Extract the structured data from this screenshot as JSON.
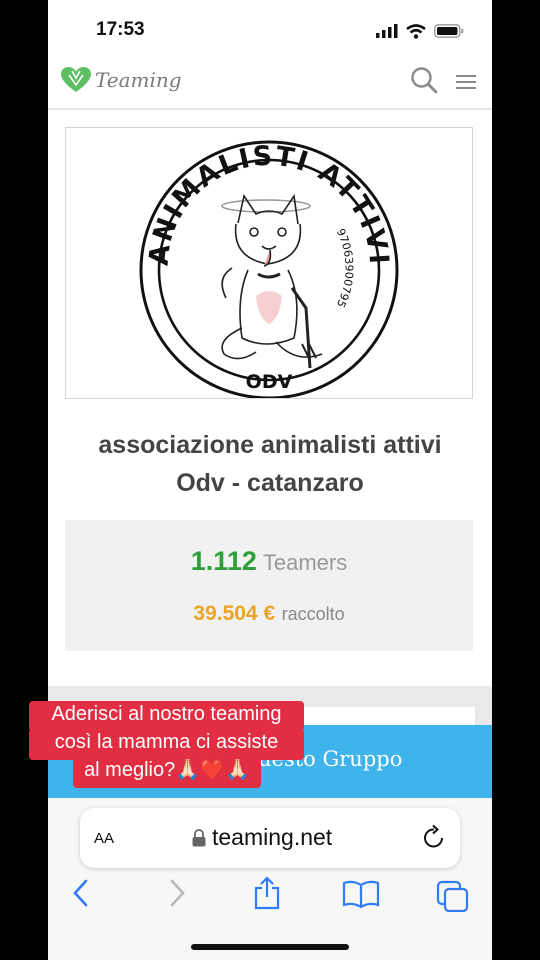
{
  "status_bar": {
    "time": "17:53"
  },
  "site_header": {
    "logo_text": "Teaming"
  },
  "group": {
    "logo_text": "ANIMALISTI ATTIVI",
    "logo_bottom": "ODV",
    "logo_number": "97063900795",
    "name_line1": "associazione animalisti attivi",
    "name_line2": "Odv - catanzaro"
  },
  "stats": {
    "teamers_count": "1.112",
    "teamers_label": "Teamers",
    "raised_amount": "39.504 €",
    "raised_label": "raccolto"
  },
  "banner": {
    "text": "uesto Gruppo"
  },
  "caption": {
    "line1": "Aderisci al nostro teaming",
    "line2": "così la mamma ci assiste",
    "line3": "al meglio?🙏🏻❤️🙏🏻"
  },
  "browser": {
    "aa_label": "AA",
    "url": "teaming.net"
  },
  "colors": {
    "green": "#2e9e3a",
    "orange": "#eba428",
    "banner_blue": "#3fb3ec",
    "caption_red": "#e12e43",
    "ios_blue": "#2f7cf6"
  },
  "icons": [
    "signal-icon",
    "wifi-icon",
    "battery-icon",
    "heart-logo-icon",
    "search-icon",
    "menu-icon",
    "lock-icon",
    "reload-icon",
    "back-icon",
    "forward-icon",
    "share-icon",
    "bookmarks-icon",
    "tabs-icon"
  ]
}
